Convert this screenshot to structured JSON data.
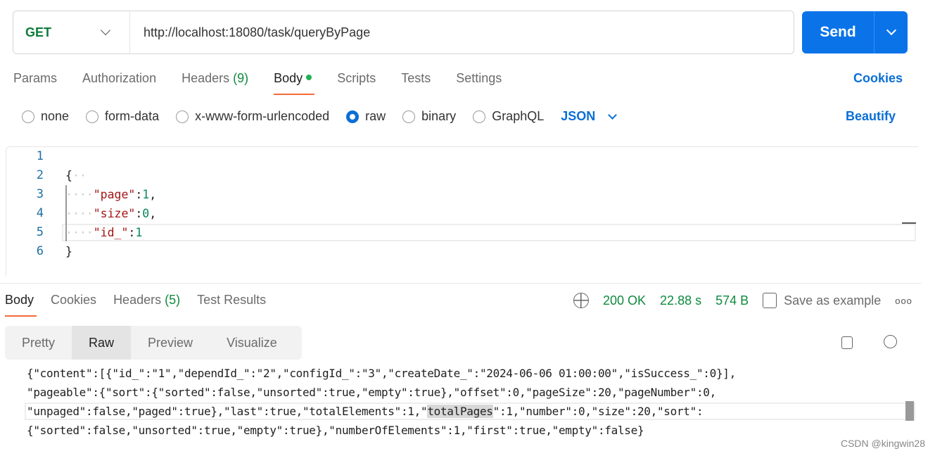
{
  "request": {
    "method": "GET",
    "url": "http://localhost:18080/task/queryByPage",
    "send_label": "Send"
  },
  "req_tabs": {
    "params": "Params",
    "authorization": "Authorization",
    "headers": "Headers",
    "headers_count": "(9)",
    "body": "Body",
    "scripts": "Scripts",
    "tests": "Tests",
    "settings": "Settings",
    "cookies": "Cookies"
  },
  "body_types": {
    "none": "none",
    "form_data": "form-data",
    "urlencoded": "x-www-form-urlencoded",
    "raw": "raw",
    "binary": "binary",
    "graphql": "GraphQL",
    "selected": "raw",
    "format": "JSON",
    "beautify": "Beautify"
  },
  "editor": {
    "line_numbers": [
      "1",
      "2",
      "3",
      "4",
      "5",
      "6"
    ],
    "lines": {
      "l2": "{",
      "l3_key": "\"page\"",
      "l3_val": "1",
      "l4_key": "\"size\"",
      "l4_val": "0",
      "l5_key": "\"id_\"",
      "l5_val": "1",
      "l6": "}"
    }
  },
  "resp_tabs": {
    "body": "Body",
    "cookies": "Cookies",
    "headers": "Headers",
    "headers_count": "(5)",
    "test_results": "Test Results"
  },
  "status": {
    "code": "200 OK",
    "time": "22.88 s",
    "size": "574 B",
    "save": "Save as example",
    "color": "#0f8a3e"
  },
  "view_modes": {
    "pretty": "Pretty",
    "raw": "Raw",
    "preview": "Preview",
    "visualize": "Visualize",
    "selected": "Raw"
  },
  "response": {
    "line1": "{\"content\":[{\"id_\":\"1\",\"dependId_\":\"2\",\"configId_\":\"3\",\"createDate_\":\"2024-06-06 01:00:00\",\"isSuccess_\":0}],",
    "line2": "\"pageable\":{\"sort\":{\"sorted\":false,\"unsorted\":true,\"empty\":true},\"offset\":0,\"pageSize\":20,\"pageNumber\":0,",
    "line3a": "\"unpaged\":false,\"paged\":true},\"last\":true,\"totalElements\":1,\"",
    "line3b": "totalPages",
    "line3c": "\":1,\"number\":0,\"size\":20,\"sort\":",
    "line4": "{\"sorted\":false,\"unsorted\":true,\"empty\":true},\"numberOfElements\":1,\"first\":true,\"empty\":false}"
  },
  "watermark": "CSDN @kingwin28",
  "colors": {
    "accent": "#0a73e8",
    "tab_underline": "#f26b3a"
  }
}
